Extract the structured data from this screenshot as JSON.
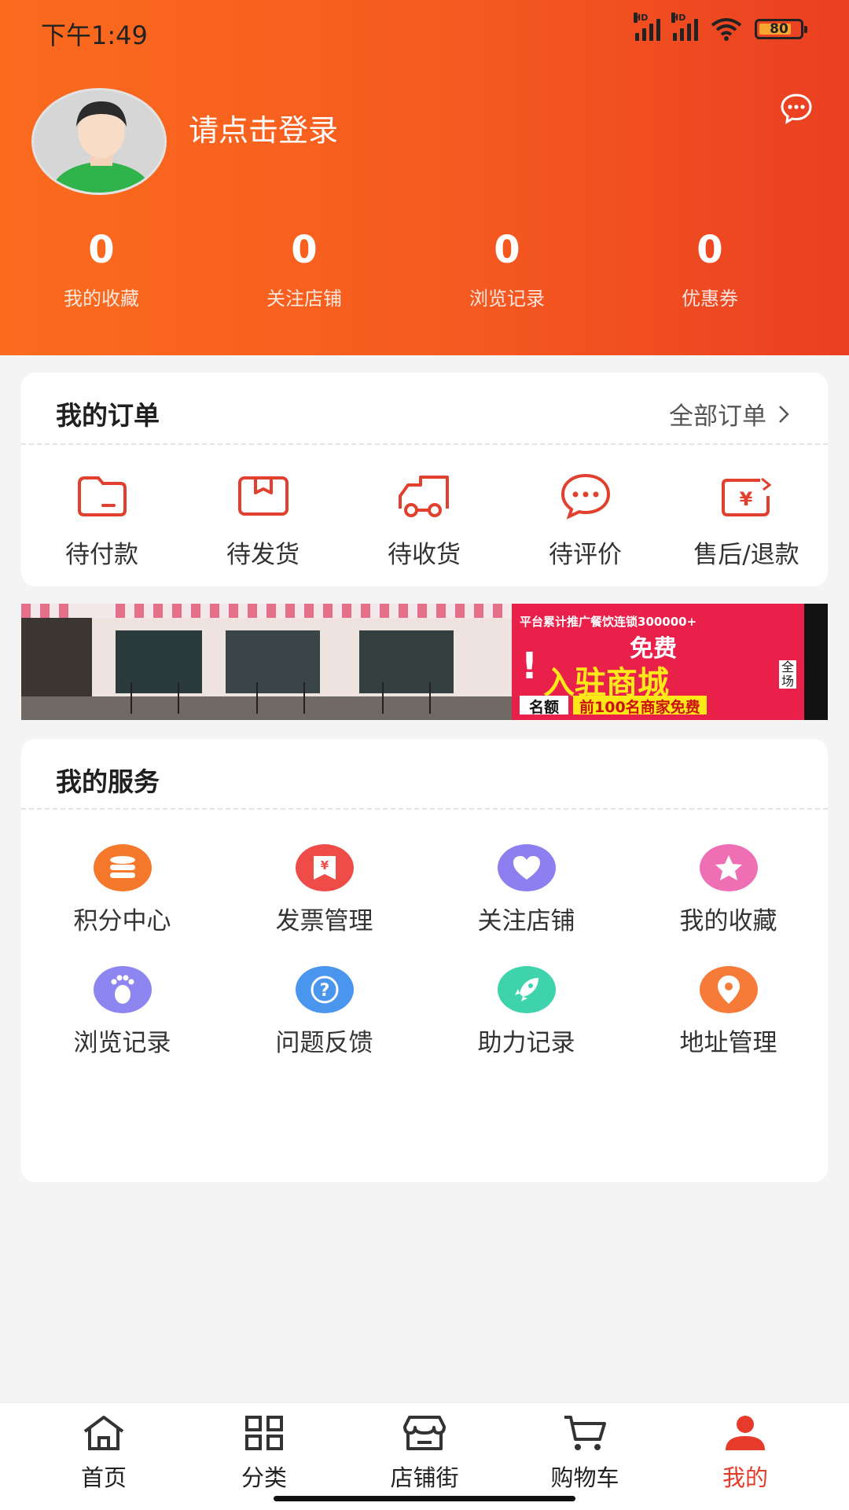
{
  "status_bar": {
    "time": "下午1:49",
    "battery": "80",
    "network_badge": "HD"
  },
  "profile": {
    "login_prompt": "请点击登录",
    "avatar": "default-user-avatar",
    "message_icon": "chat-bubble-icon"
  },
  "stats": [
    {
      "value": "0",
      "label": "我的收藏"
    },
    {
      "value": "0",
      "label": "关注店铺"
    },
    {
      "value": "0",
      "label": "浏览记录"
    },
    {
      "value": "0",
      "label": "优惠券"
    }
  ],
  "orders": {
    "title": "我的订单",
    "all_link": "全部订单",
    "items": [
      {
        "label": "待付款",
        "icon": "wallet-icon"
      },
      {
        "label": "待发货",
        "icon": "package-icon"
      },
      {
        "label": "待收货",
        "icon": "truck-icon"
      },
      {
        "label": "待评价",
        "icon": "comment-icon"
      },
      {
        "label": "售后/退款",
        "icon": "refund-icon"
      }
    ]
  },
  "banner": {
    "line1": "平台累计推广餐饮连锁300000+",
    "line2": "免费",
    "line3": "入驻商城",
    "side": "全场",
    "tag": "名额",
    "tag_text": "前100名商家免费"
  },
  "services": {
    "title": "我的服务",
    "items": [
      {
        "label": "积分中心",
        "icon": "coins-icon",
        "color": "#f6782a"
      },
      {
        "label": "发票管理",
        "icon": "invoice-icon",
        "color": "#ef4b48"
      },
      {
        "label": "关注店铺",
        "icon": "heart-icon",
        "color": "#8d7ff0"
      },
      {
        "label": "我的收藏",
        "icon": "star-icon",
        "color": "#ef6fb5"
      },
      {
        "label": "浏览记录",
        "icon": "footprint-icon",
        "color": "#8e86f0"
      },
      {
        "label": "问题反馈",
        "icon": "question-icon",
        "color": "#4a95ee"
      },
      {
        "label": "助力记录",
        "icon": "rocket-icon",
        "color": "#3ed3ad"
      },
      {
        "label": "地址管理",
        "icon": "location-icon",
        "color": "#f67a38"
      }
    ]
  },
  "tabbar": [
    {
      "label": "首页",
      "icon": "home-icon"
    },
    {
      "label": "分类",
      "icon": "category-icon"
    },
    {
      "label": "店铺街",
      "icon": "store-icon"
    },
    {
      "label": "购物车",
      "icon": "cart-icon"
    },
    {
      "label": "我的",
      "icon": "user-icon",
      "active": true
    }
  ],
  "colors": {
    "primary": "#f55a20",
    "accent_red": "#e63b2a",
    "order_icon": "#e0402d"
  }
}
